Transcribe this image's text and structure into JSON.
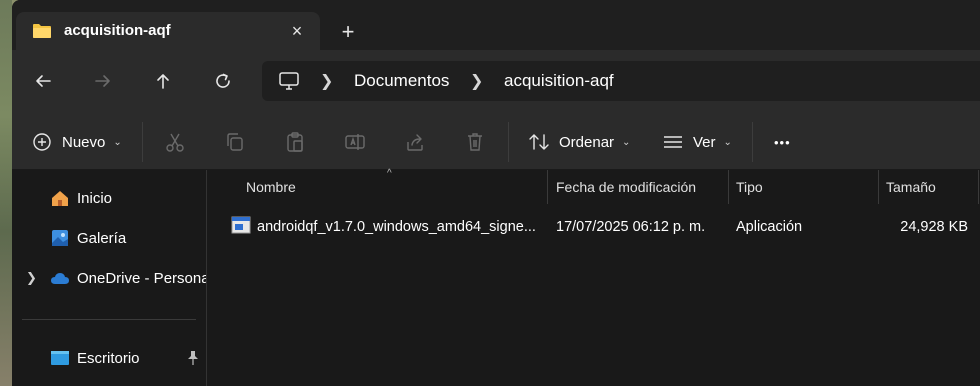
{
  "tab": {
    "title": "acquisition-aqf",
    "close": "×",
    "new_tab": "+"
  },
  "address": {
    "crumbs": [
      "Documentos",
      "acquisition-aqf"
    ]
  },
  "commands": {
    "new_label": "Nuevo",
    "sort_label": "Ordenar",
    "view_label": "Ver",
    "more_label": "•••"
  },
  "sidebar": {
    "items": [
      {
        "label": "Inicio"
      },
      {
        "label": "Galería"
      },
      {
        "label": "OneDrive - Persona"
      },
      {
        "label": "Escritorio"
      }
    ]
  },
  "columns": {
    "name": "Nombre",
    "modified": "Fecha de modificación",
    "type": "Tipo",
    "size": "Tamaño"
  },
  "files": [
    {
      "name": "androidqf_v1.7.0_windows_amd64_signe...",
      "modified": "17/07/2025 06:12 p. m.",
      "type": "Aplicación",
      "size": "24,928 KB"
    }
  ],
  "colors": {
    "folder": "#f4c542",
    "onedrive": "#2b7cd3",
    "accent": "#4aa0e6"
  }
}
